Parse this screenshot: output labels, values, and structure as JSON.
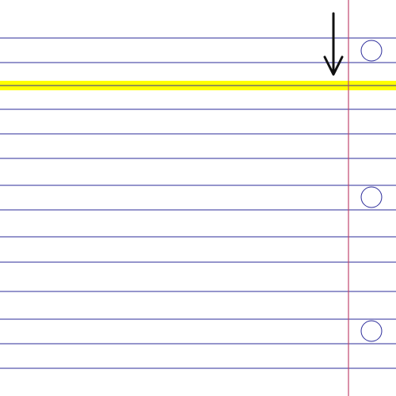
{
  "colors": {
    "background": "#ffffff",
    "rule_line": "#2b2b9a",
    "margin_line": "#c0466e",
    "highlight": "#ffff00",
    "arrow": "#111111",
    "hole_stroke": "#2b2b9a"
  },
  "paper": {
    "ruled_line_count": 14,
    "binder_hole_count": 3,
    "highlighted_line_index": 2
  },
  "pointer": {
    "icon": "down-arrow-icon",
    "points_to_line_index": 2
  }
}
